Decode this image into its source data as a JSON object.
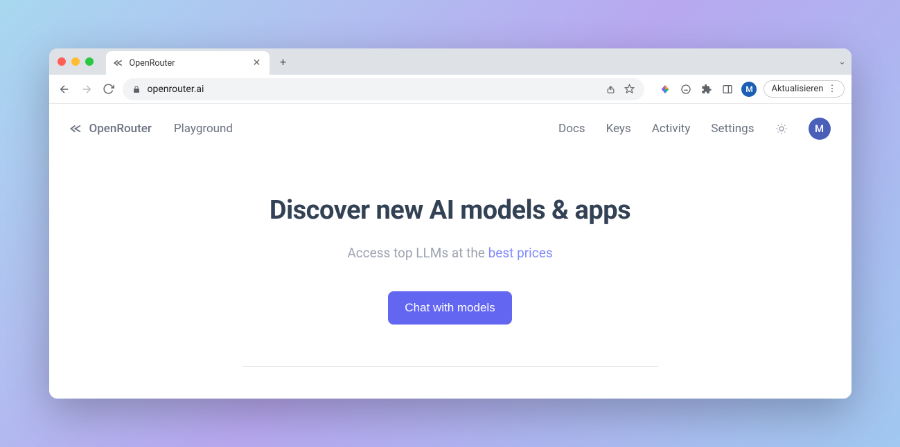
{
  "browser": {
    "tab_title": "OpenRouter",
    "url": "openrouter.ai",
    "profile_initial": "M",
    "update_label": "Aktualisieren"
  },
  "nav": {
    "brand": "OpenRouter",
    "links_left": [
      "Playground"
    ],
    "links_right": [
      "Docs",
      "Keys",
      "Activity",
      "Settings"
    ],
    "avatar_initial": "M"
  },
  "hero": {
    "title": "Discover new AI models & apps",
    "subtitle_prefix": "Access top LLMs at the ",
    "subtitle_link": "best prices",
    "cta_label": "Chat with models"
  }
}
